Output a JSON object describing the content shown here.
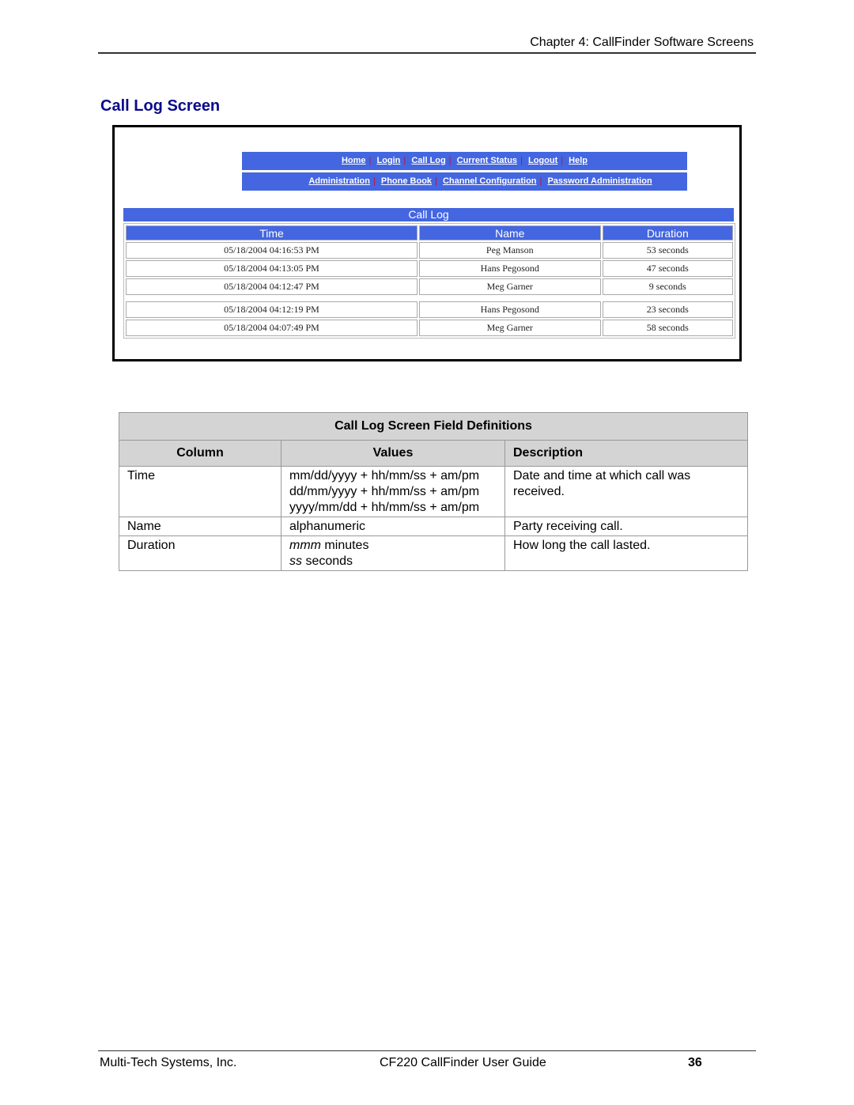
{
  "header": {
    "chapter": "Chapter 4:  CallFinder Software Screens"
  },
  "section_title": "Call Log Screen",
  "screenshot": {
    "nav_top": [
      "Home",
      "Login",
      "Call Log",
      "Current Status",
      "Logout",
      "Help"
    ],
    "nav_bottom": [
      "Administration",
      "Phone Book",
      "Channel Configuration",
      "Password Administration"
    ],
    "colors": {
      "nav_bg": "#4466e0",
      "separator": "#c0103a"
    },
    "call_log": {
      "title": "Call Log",
      "columns": [
        "Time",
        "Name",
        "Duration"
      ],
      "rows": [
        {
          "time": "05/18/2004 04:16:53 PM",
          "name": "Peg Manson",
          "duration": "53 seconds"
        },
        {
          "time": "05/18/2004 04:13:05 PM",
          "name": "Hans Pegosond",
          "duration": "47 seconds"
        },
        {
          "time": "05/18/2004 04:12:47 PM",
          "name": "Meg Garner",
          "duration": "9 seconds"
        },
        {
          "time": "05/18/2004 04:12:19 PM",
          "name": "Hans Pegosond",
          "duration": "23 seconds"
        },
        {
          "time": "05/18/2004 04:07:49 PM",
          "name": "Meg Garner",
          "duration": "58 seconds"
        }
      ]
    }
  },
  "definitions": {
    "caption": "Call Log Screen Field Definitions",
    "headers": [
      "Column",
      "Values",
      "Description"
    ],
    "rows": [
      {
        "column": "Time",
        "values": [
          "mm/dd/yyyy + hh/mm/ss + am/pm",
          "dd/mm/yyyy + hh/mm/ss + am/pm",
          "yyyy/mm/dd + hh/mm/ss + am/pm"
        ],
        "description": "Date and time at which call was received."
      },
      {
        "column": "Name",
        "values": [
          "alphanumeric"
        ],
        "description": "Party receiving call."
      },
      {
        "column": "Duration",
        "values_italic": [
          [
            "mmm",
            " minutes"
          ],
          [
            "ss",
            " seconds"
          ]
        ],
        "description": "How long the call lasted."
      }
    ]
  },
  "footer": {
    "company": "Multi-Tech Systems, Inc.",
    "guide": "CF220 CallFinder User Guide",
    "page": "36"
  }
}
